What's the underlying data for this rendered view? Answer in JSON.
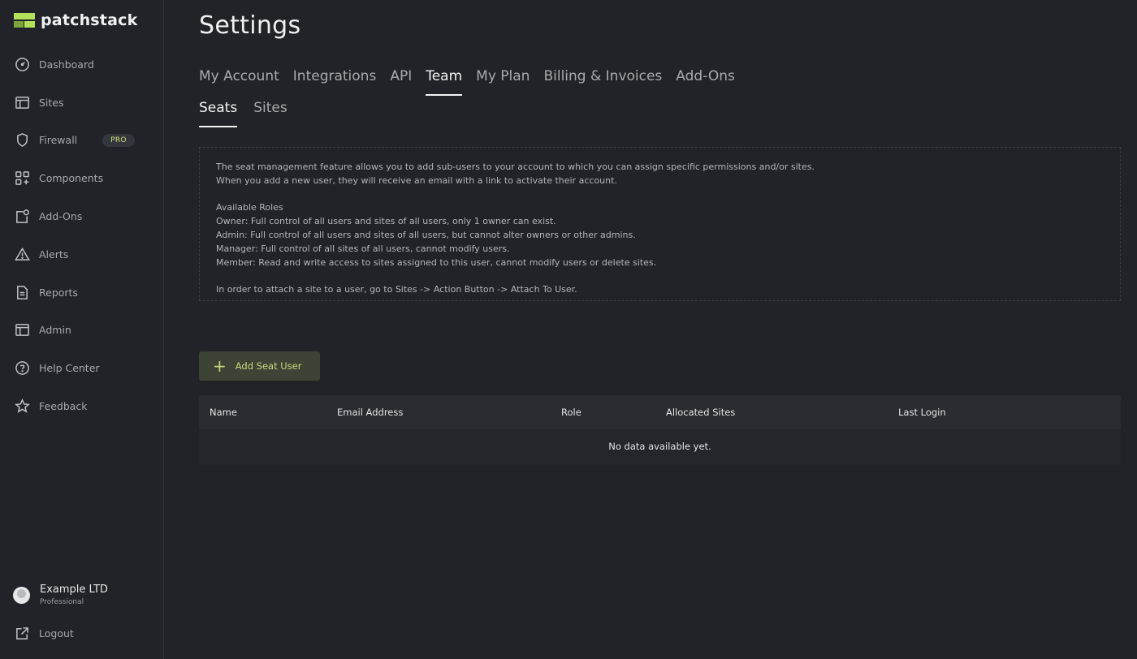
{
  "brand": {
    "name": "patchstack"
  },
  "sidebar": {
    "items": [
      {
        "label": "Dashboard",
        "icon": "gauge-icon"
      },
      {
        "label": "Sites",
        "icon": "layout-icon"
      },
      {
        "label": "Firewall",
        "icon": "shield-icon",
        "badge": "PRO"
      },
      {
        "label": "Components",
        "icon": "grid-plus-icon"
      },
      {
        "label": "Add-Ons",
        "icon": "addon-icon"
      },
      {
        "label": "Alerts",
        "icon": "warning-icon"
      },
      {
        "label": "Reports",
        "icon": "document-icon"
      },
      {
        "label": "Admin",
        "icon": "layout-icon"
      },
      {
        "label": "Help Center",
        "icon": "help-icon"
      },
      {
        "label": "Feedback",
        "icon": "star-icon"
      }
    ],
    "account": {
      "name": "Example LTD",
      "plan": "Professional"
    },
    "logout_label": "Logout"
  },
  "page": {
    "title": "Settings"
  },
  "tabs": [
    {
      "label": "My Account",
      "active": false
    },
    {
      "label": "Integrations",
      "active": false
    },
    {
      "label": "API",
      "active": false
    },
    {
      "label": "Team",
      "active": true
    },
    {
      "label": "My Plan",
      "active": false
    },
    {
      "label": "Billing & Invoices",
      "active": false
    },
    {
      "label": "Add-Ons",
      "active": false
    }
  ],
  "subtabs": [
    {
      "label": "Seats",
      "active": true
    },
    {
      "label": "Sites",
      "active": false
    }
  ],
  "info": {
    "lines": [
      "The seat management feature allows you to add sub-users to your account to which you can assign specific permissions and/or sites.",
      "When you add a new user, they will receive an email with a link to activate their account.",
      "",
      "Available Roles",
      "Owner: Full control of all users and sites of all users, only 1 owner can exist.",
      "Admin: Full control of all users and sites of all users, but cannot alter owners or other admins.",
      "Manager: Full control of all sites of all users, cannot modify users.",
      "Member: Read and write access to sites assigned to this user, cannot modify users or delete sites.",
      "",
      "In order to attach a site to a user, go to Sites -> Action Button -> Attach To User."
    ]
  },
  "add_button": {
    "label": "Add Seat User"
  },
  "table": {
    "columns": [
      "Name",
      "Email Address",
      "Role",
      "Allocated Sites",
      "Last Login"
    ],
    "empty_text": "No data available yet."
  },
  "colors": {
    "accent": "#b4e15a",
    "background": "#212328",
    "button_bg": "#3d4436"
  }
}
